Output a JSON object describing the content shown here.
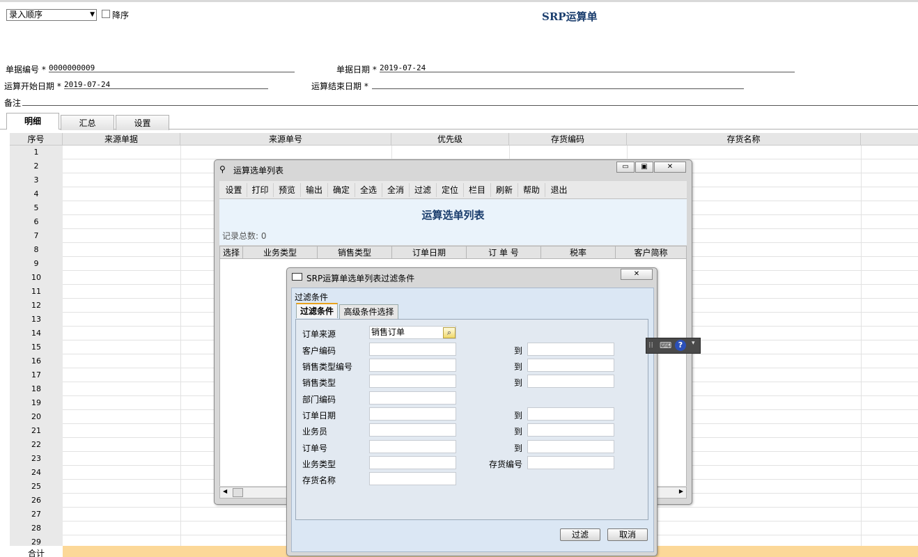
{
  "header": {
    "sort_value": "录入顺序",
    "desc_label": "降序",
    "title": "SRP运算单"
  },
  "form": {
    "doc_no_label": "单据编号",
    "doc_no_value": "0000000009",
    "doc_date_label": "单据日期",
    "doc_date_value": "2019-07-24",
    "start_date_label": "运算开始日期",
    "start_date_value": "2019-07-24",
    "end_date_label": "运算结束日期",
    "end_date_value": "",
    "remark_label": "备注",
    "required_mark": "*"
  },
  "tabs": [
    "明细",
    "汇总",
    "设置"
  ],
  "grid": {
    "columns": [
      "序号",
      "来源单据",
      "来源单号",
      "优先级",
      "存货编码",
      "存货名称"
    ],
    "row_numbers": [
      "1",
      "2",
      "3",
      "4",
      "5",
      "6",
      "7",
      "8",
      "9",
      "10",
      "11",
      "12",
      "13",
      "14",
      "15",
      "16",
      "17",
      "18",
      "19",
      "20",
      "21",
      "22",
      "23",
      "24",
      "25",
      "26",
      "27",
      "28",
      "29"
    ],
    "total_label": "合计"
  },
  "list_window": {
    "title": "运算选单列表",
    "toolbar": [
      "设置",
      "打印",
      "预览",
      "输出",
      "确定",
      "全选",
      "全消",
      "过滤",
      "定位",
      "栏目",
      "刷新",
      "帮助",
      "退出"
    ],
    "heading": "运算选单列表",
    "record_count": "记录总数: 0",
    "columns": [
      "选择",
      "业务类型",
      "销售类型",
      "订单日期",
      "订 单 号",
      "税率",
      "客户简称"
    ]
  },
  "filter_dialog": {
    "title": "SRP运算单选单列表过滤条件",
    "group_label": "过滤条件",
    "tabs": [
      "过滤条件",
      "高级条件选择"
    ],
    "fields": {
      "order_source_label": "订单来源",
      "order_source_value": "销售订单",
      "customer_code_label": "客户编码",
      "sales_type_code_label": "销售类型编号",
      "sales_type_label": "销售类型",
      "dept_code_label": "部门编码",
      "order_date_label": "订单日期",
      "salesperson_label": "业务员",
      "order_no_label": "订单号",
      "business_type_label": "业务类型",
      "inventory_name_label": "存货名称",
      "to_label": "到",
      "inventory_no_label": "存货编号"
    },
    "filter_button": "过滤",
    "cancel_button": "取消"
  },
  "colors": {
    "title_blue": "#1a3d6d",
    "total_row": "#fcd898",
    "tab_accent": "#e8a21c"
  }
}
